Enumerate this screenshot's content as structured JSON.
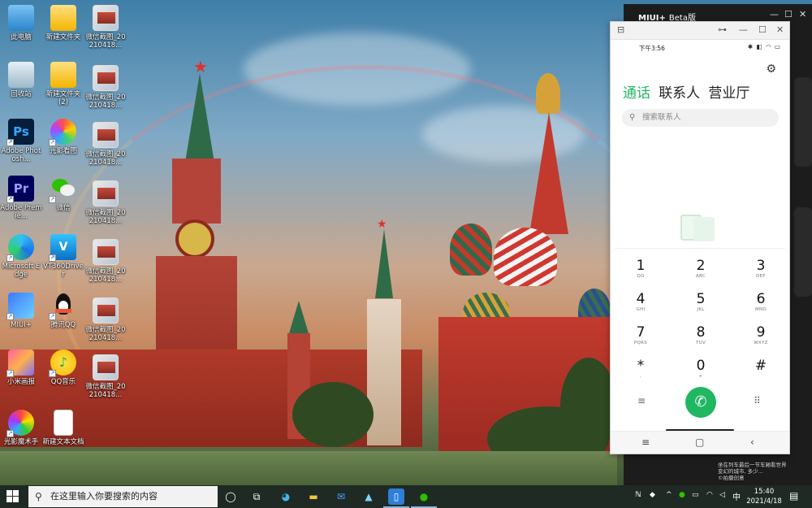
{
  "desktop": {
    "icons": [
      {
        "label": "此电脑",
        "icon": "computer-icon"
      },
      {
        "label": "新建文件夹",
        "icon": "folder-icon"
      },
      {
        "label": "微信截图_20210418...",
        "icon": "image-file-icon"
      },
      {
        "label": "回收站",
        "icon": "recycle-bin-icon"
      },
      {
        "label": "新建文件夹 (2)",
        "icon": "folder-icon"
      },
      {
        "label": "微信截图_20210418...",
        "icon": "image-file-icon"
      },
      {
        "label": "Adobe Photosh...",
        "icon": "photoshop-icon"
      },
      {
        "label": "光影看图",
        "icon": "photo-viewer-icon"
      },
      {
        "label": "微信截图_20210418...",
        "icon": "image-file-icon"
      },
      {
        "label": "Adobe Premie...",
        "icon": "premiere-icon"
      },
      {
        "label": "微信",
        "icon": "wechat-icon"
      },
      {
        "label": "微信截图_20210418...",
        "icon": "image-file-icon"
      },
      {
        "label": "Microsoft Edge",
        "icon": "edge-icon"
      },
      {
        "label": "VT360Driver",
        "icon": "vt360-icon"
      },
      {
        "label": "微信截图_20210418...",
        "icon": "image-file-icon"
      },
      {
        "label": "MIUI+",
        "icon": "miui-plus-icon"
      },
      {
        "label": "腾讯QQ",
        "icon": "qq-icon"
      },
      {
        "label": "微信截图_20210418...",
        "icon": "image-file-icon"
      },
      {
        "label": "小米画报",
        "icon": "mi-wallpaper-icon"
      },
      {
        "label": "QQ音乐",
        "icon": "qq-music-icon"
      },
      {
        "label": "微信截图_20210418...",
        "icon": "image-file-icon"
      },
      {
        "label": "光影魔术手",
        "icon": "nEO-imaging-icon"
      },
      {
        "label": "新建文本文档",
        "icon": "text-document-icon"
      }
    ]
  },
  "miui_window": {
    "title": "MIUI+",
    "badge": "Beta版",
    "controls": [
      "—",
      "☐",
      "✕"
    ]
  },
  "phone_window": {
    "toolbar": {
      "controls": [
        "⊟",
        "⊶",
        "—",
        "☐",
        "✕"
      ]
    },
    "status": {
      "time": "下午3:56",
      "indicators": "✱ ◧ ◠ ▭"
    },
    "tabs": [
      {
        "label": "通话",
        "active": true
      },
      {
        "label": "联系人",
        "active": false
      },
      {
        "label": "营业厅",
        "active": false
      }
    ],
    "search": {
      "placeholder": "搜索联系人"
    },
    "keypad": [
      {
        "digit": "1",
        "letters": "QO"
      },
      {
        "digit": "2",
        "letters": "ABC"
      },
      {
        "digit": "3",
        "letters": "DEF"
      },
      {
        "digit": "4",
        "letters": "GHI"
      },
      {
        "digit": "5",
        "letters": "JKL"
      },
      {
        "digit": "6",
        "letters": "MNO"
      },
      {
        "digit": "7",
        "letters": "PQRS"
      },
      {
        "digit": "8",
        "letters": "TUV"
      },
      {
        "digit": "9",
        "letters": "WXYZ"
      },
      {
        "digit": "*",
        "letters": ","
      },
      {
        "digit": "0",
        "letters": "+"
      },
      {
        "digit": "#",
        "letters": ""
      }
    ],
    "call_symbol": "✆",
    "menu_symbol": "≡",
    "dialpad_symbol": "⠿",
    "nav": {
      "menu": "≡",
      "home": "▢",
      "back": "‹"
    }
  },
  "watermark": {
    "line1": "坐在列车最后一节车厢看世界",
    "line2": "变幻的城市, 多少...",
    "line3": "©拍摄创意"
  },
  "taskbar": {
    "search_placeholder": "在这里输入你要搜索的内容",
    "tray": {
      "input_method": "中",
      "time": "15:40",
      "date": "2021/4/18"
    }
  },
  "colors": {
    "accent_green": "#1fb761",
    "taskbar_bg": "#1f2a24",
    "miui_dark": "#1c1c1c"
  }
}
